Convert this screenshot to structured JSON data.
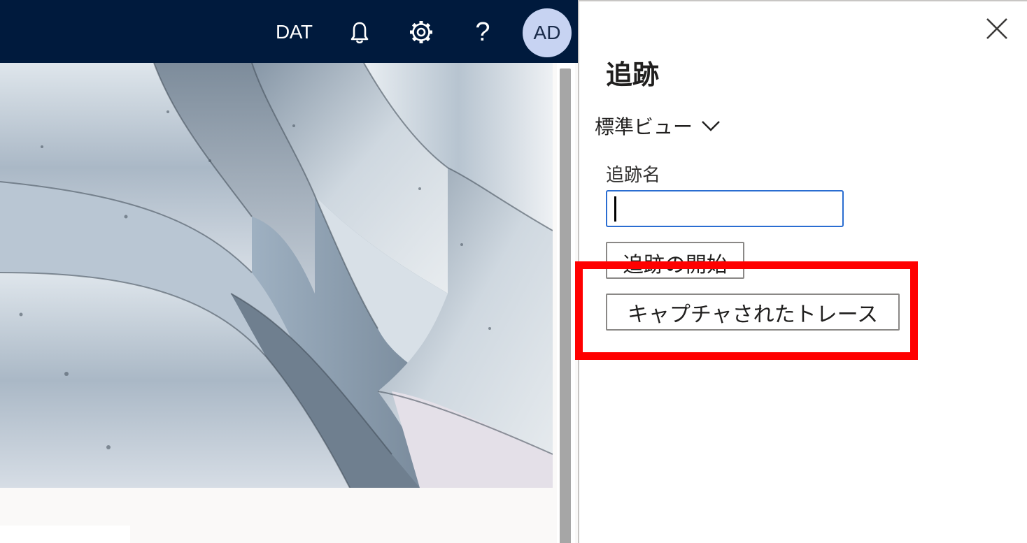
{
  "header": {
    "company": "DAT",
    "avatar_initials": "AD",
    "help_glyph": "?",
    "icons": [
      "bell-icon",
      "gear-icon",
      "help-icon"
    ],
    "background_color": "#001a3d"
  },
  "trace_pane": {
    "title": "追跡",
    "view_selector": "標準ビュー",
    "field_label": "追跡名",
    "trace_name_value": "",
    "start_button_label": "追跡の開始",
    "captured_traces_button_label": "キャプチャされたトレース"
  },
  "annotation": {
    "highlight_color": "#ff0000"
  }
}
